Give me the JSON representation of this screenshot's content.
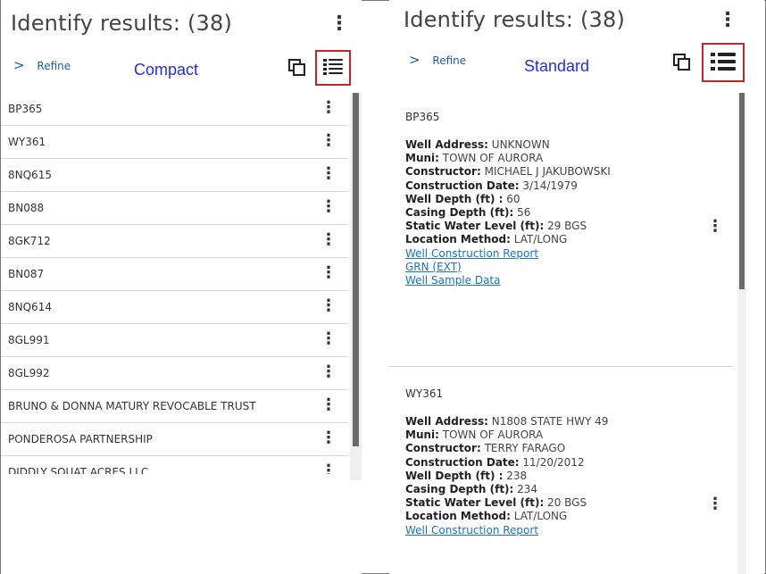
{
  "left": {
    "title": "Identify results: (38)",
    "refine": "Refine",
    "mode_label": "Compact",
    "items": [
      "BP365",
      "WY361",
      "8NQ615",
      "BN088",
      "8GK712",
      "BN087",
      "8NQ614",
      "8GL991",
      "8GL992",
      "BRUNO & DONNA MATURY REVOCABLE TRUST",
      "PONDEROSA PARTNERSHIP",
      "DIDDLY SQUAT ACRES LLC"
    ]
  },
  "right": {
    "title": "Identify results: (38)",
    "refine": "Refine",
    "mode_label": "Standard",
    "records": [
      {
        "id": "BP365",
        "fields": [
          {
            "k": "Well Address:",
            "v": " UNKNOWN"
          },
          {
            "k": "Muni:",
            "v": " TOWN OF AURORA"
          },
          {
            "k": "Constructor:",
            "v": "  MICHAEL J JAKUBOWSKI"
          },
          {
            "k": "Construction Date:",
            "v": "  3/14/1979"
          },
          {
            "k": "Well Depth (ft) :",
            "v": "  60"
          },
          {
            "k": "Casing Depth (ft):",
            "v": " 56"
          },
          {
            "k": "Static Water Level (ft):",
            "v": " 29 BGS"
          },
          {
            "k": "Location Method:",
            "v": " LAT/LONG"
          }
        ],
        "links": [
          "Well Construction Report",
          "GRN (EXT)",
          "Well Sample Data"
        ]
      },
      {
        "id": "WY361",
        "fields": [
          {
            "k": "Well Address:",
            "v": " N1808 STATE HWY 49"
          },
          {
            "k": "Muni:",
            "v": " TOWN OF AURORA"
          },
          {
            "k": "Constructor:",
            "v": "  TERRY FARAGO"
          },
          {
            "k": "Construction Date:",
            "v": "  11/20/2012"
          },
          {
            "k": "Well Depth (ft) :",
            "v": "  238"
          },
          {
            "k": "Casing Depth (ft):",
            "v": " 234"
          },
          {
            "k": "Static Water Level (ft):",
            "v": " 20 BGS"
          },
          {
            "k": "Location Method:",
            "v": " LAT/LONG"
          }
        ],
        "links": [
          "Well Construction Report"
        ]
      }
    ]
  },
  "icons": {
    "more": "more-vert-icon",
    "copy": "copy-icon",
    "compact_list": "compact-list-icon",
    "standard_list": "standard-list-icon",
    "chevron": "chevron-right-icon"
  },
  "colors": {
    "mode_label": "#1f2fe6",
    "highlight_border": "#c0262a",
    "link": "#1a73c7"
  }
}
